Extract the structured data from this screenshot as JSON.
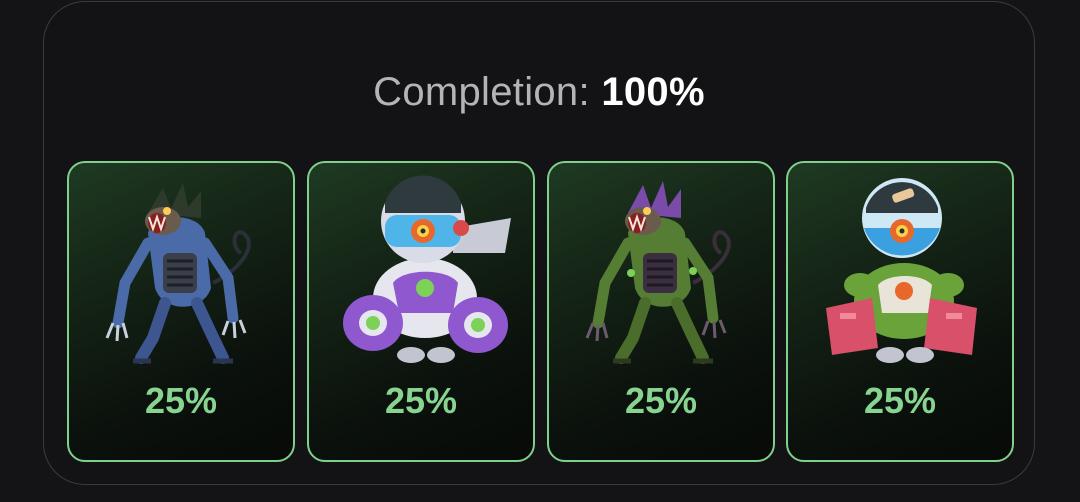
{
  "completion": {
    "label": "Completion:",
    "value": "100%"
  },
  "cards": [
    {
      "name": "blue-rat-mech",
      "icon": "rat-monster-icon",
      "percent": "25%",
      "accent": "#5b7fc0"
    },
    {
      "name": "purple-astronaut-robot",
      "icon": "astronaut-robot-icon",
      "percent": "25%",
      "accent": "#9b63d8"
    },
    {
      "name": "green-rat-mech",
      "icon": "rat-monster-icon",
      "percent": "25%",
      "accent": "#5f8a3a"
    },
    {
      "name": "green-red-astronaut-robot",
      "icon": "astronaut-robot-icon",
      "percent": "25%",
      "accent": "#d8506a"
    }
  ],
  "colors": {
    "border": "#7fd08a",
    "percent_text": "#86d48f",
    "background": "#141416"
  }
}
